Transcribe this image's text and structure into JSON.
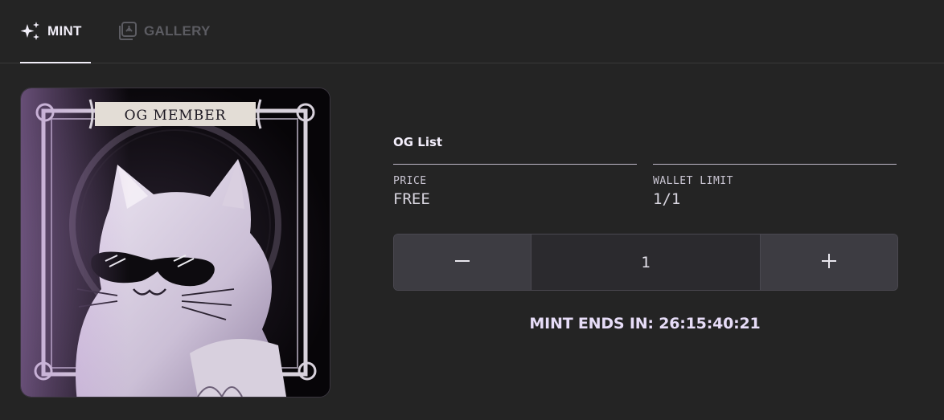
{
  "tabs": {
    "mint": {
      "label": "MINT",
      "icon": "sparkles-icon",
      "active": true
    },
    "gallery": {
      "label": "GALLERY",
      "icon": "gallery-icon",
      "active": false
    }
  },
  "artwork": {
    "banner_text": "OG MEMBER",
    "subject": "cat-with-sunglasses-illustration"
  },
  "mint_panel": {
    "list_name": "OG List",
    "price": {
      "label": "PRICE",
      "value": "FREE"
    },
    "wallet_limit": {
      "label": "WALLET LIMIT",
      "value": "1/1"
    },
    "quantity": {
      "value": "1",
      "decrement_icon": "minus-icon",
      "increment_icon": "plus-icon"
    },
    "countdown": "MINT ENDS IN: 26:15:40:21"
  },
  "colors": {
    "background": "#242424",
    "accent_text": "#e7ddf8",
    "button_bg": "#3d3c42"
  }
}
